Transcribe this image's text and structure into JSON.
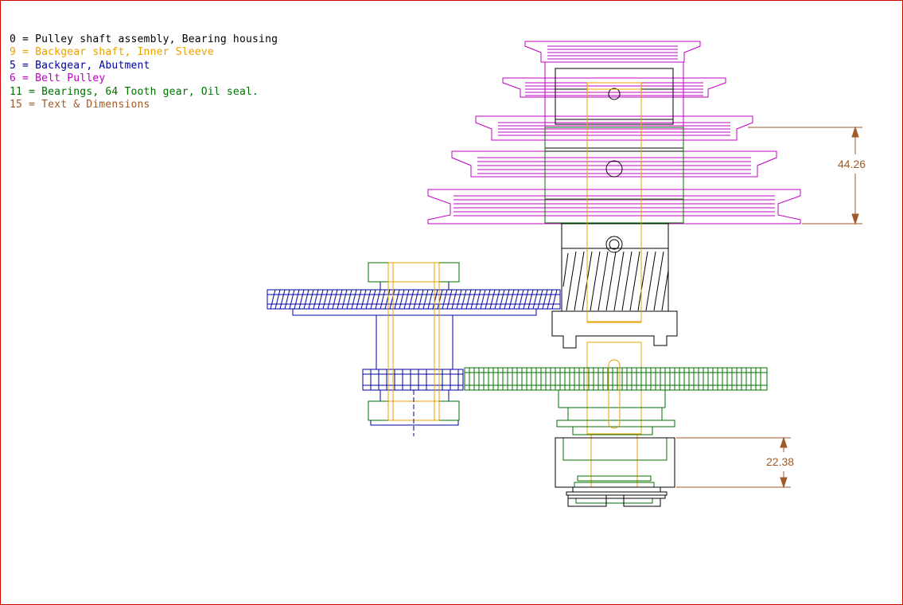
{
  "legend": [
    {
      "text": "0 = Pulley shaft assembly, Bearing housing",
      "color": "#000000"
    },
    {
      "text": "9 = Backgear shaft, Inner Sleeve",
      "color": "#e8a000"
    },
    {
      "text": "5 = Backgear, Abutment",
      "color": "#0000a0"
    },
    {
      "text": "6 = Belt Pulley",
      "color": "#c000c0"
    },
    {
      "text": "11 = Bearings, 64 Tooth gear, Oil seal.",
      "color": "#007000"
    },
    {
      "text": "15 = Text & Dimensions",
      "color": "#a05a28"
    }
  ],
  "dimensions": {
    "pulley_step": "44.26",
    "housing_height": "22.38"
  },
  "colors": {
    "frame": "#d40000",
    "shaft": "#000000",
    "sleeve": "#e8a000",
    "backgear": "#0000a0",
    "pulley": "#c000c0",
    "bearing": "#007000",
    "dimension": "#a05a28"
  }
}
